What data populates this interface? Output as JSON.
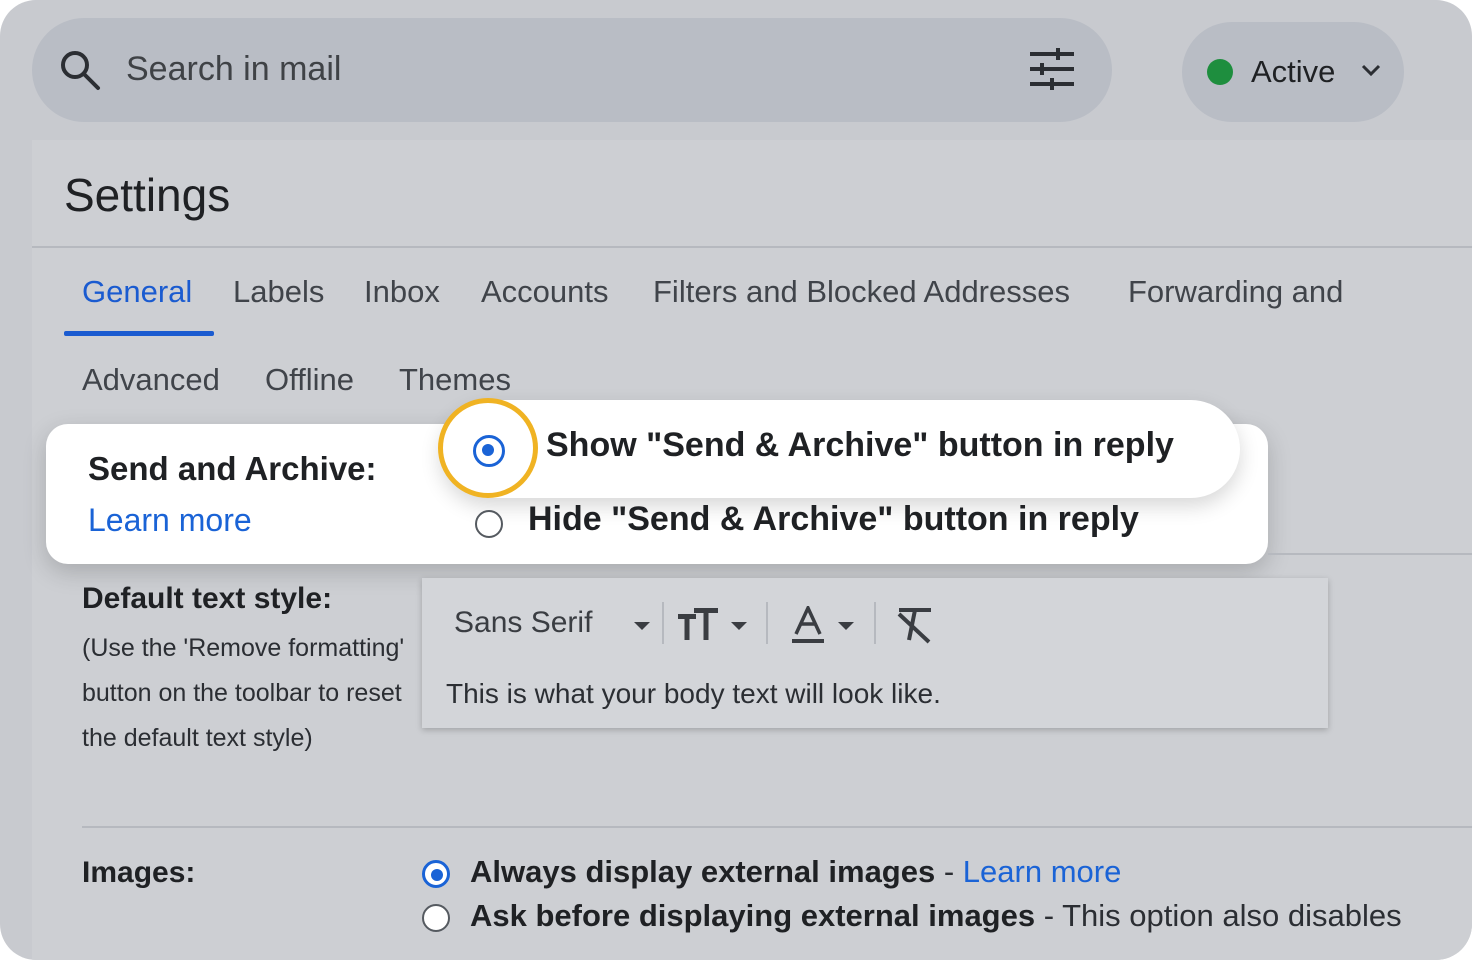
{
  "search": {
    "placeholder": "Search in mail"
  },
  "status": {
    "label": "Active",
    "color": "#1e8e3e"
  },
  "settings": {
    "title": "Settings"
  },
  "tabs": [
    {
      "label": "General",
      "active": true
    },
    {
      "label": "Labels"
    },
    {
      "label": "Inbox"
    },
    {
      "label": "Accounts"
    },
    {
      "label": "Filters and Blocked Addresses"
    },
    {
      "label": "Forwarding and"
    },
    {
      "label": "Advanced"
    },
    {
      "label": "Offline"
    },
    {
      "label": "Themes"
    }
  ],
  "send_archive": {
    "label": "Send and Archive:",
    "learn_more": "Learn more",
    "options": [
      {
        "label": "Show \"Send & Archive\" button in reply",
        "selected": true
      },
      {
        "label": "Hide \"Send & Archive\" button in reply",
        "selected": false
      }
    ]
  },
  "default_text_style": {
    "label": "Default text style:",
    "help": "(Use the 'Remove formatting' button on the toolbar to reset the default text style)",
    "font": "Sans Serif",
    "preview": "This is what your body text will look like."
  },
  "images": {
    "label": "Images:",
    "options": [
      {
        "label": "Always display external images",
        "separator": " - ",
        "link": "Learn more",
        "selected": true
      },
      {
        "label": "Ask before displaying external images",
        "separator": " - ",
        "note": "This option also disables",
        "selected": false
      }
    ]
  },
  "colors": {
    "accent": "#1a63d6",
    "highlight_ring": "#f0b323"
  }
}
